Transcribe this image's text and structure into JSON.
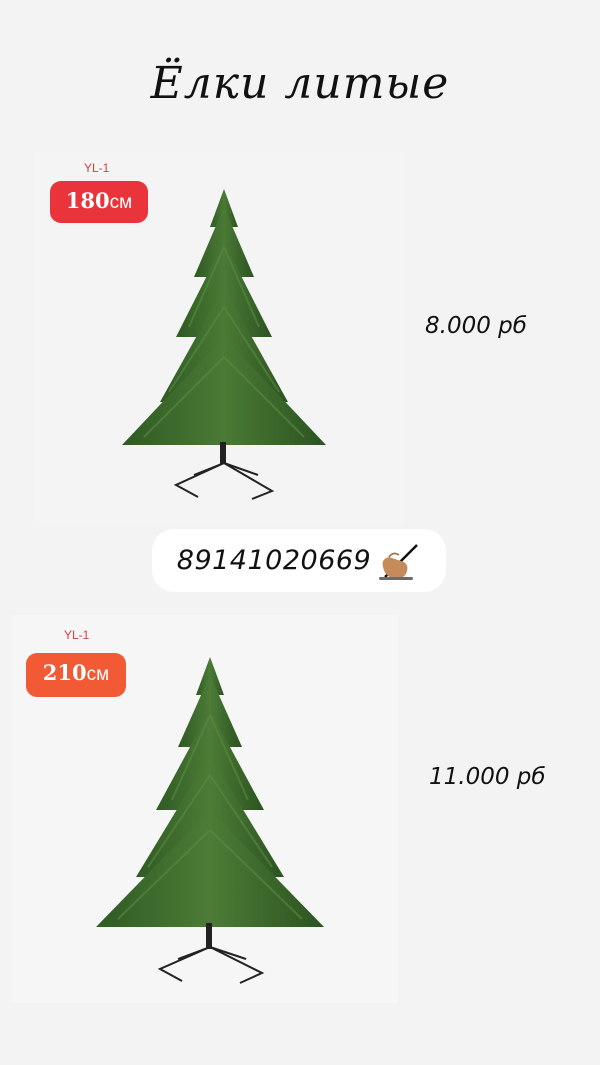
{
  "title": "Ёлки литые",
  "products": [
    {
      "model": "YL-1",
      "height_value": "180",
      "height_unit": "см",
      "price": "8.000 рб"
    },
    {
      "model": "YL-1",
      "height_value": "210",
      "height_unit": "см",
      "price": "11.000 рб"
    }
  ],
  "contact": {
    "phone": "89141020669",
    "icon": "writing-hand-icon"
  },
  "colors": {
    "badge_red": "#e8343a",
    "badge_orange": "#f15a34",
    "tree_green": "#3f6b2e"
  }
}
